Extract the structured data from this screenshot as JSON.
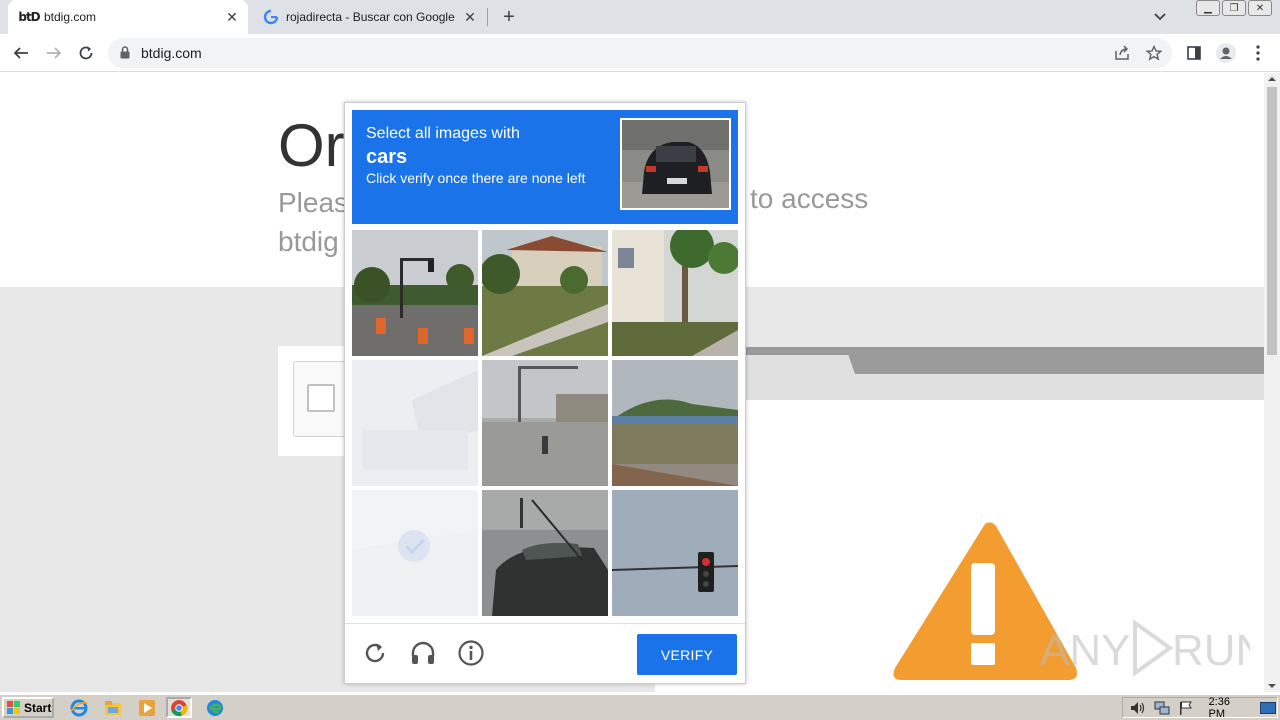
{
  "browser": {
    "tabs": [
      {
        "favicon": "btD",
        "title": "btdig.com",
        "active": true
      },
      {
        "favicon": "google-g-icon",
        "title": "rojadirecta - Buscar con Google",
        "active": false
      }
    ],
    "url": "btdig.com"
  },
  "page": {
    "heading": "Or",
    "sub_left_line1": "Pleas",
    "sub_left_line2": "btdig",
    "sub_right": "to access"
  },
  "captcha": {
    "instruction_line1": "Select all images with",
    "target": "cars",
    "instruction_line3": "Click verify once there are none left",
    "verify_label": "VERIFY"
  },
  "watermark": "ANY RUN",
  "taskbar": {
    "start_label": "Start",
    "clock": "2:36 PM"
  },
  "colors": {
    "captcha_blue": "#1a73e8",
    "warning_orange": "#f39c2f"
  }
}
